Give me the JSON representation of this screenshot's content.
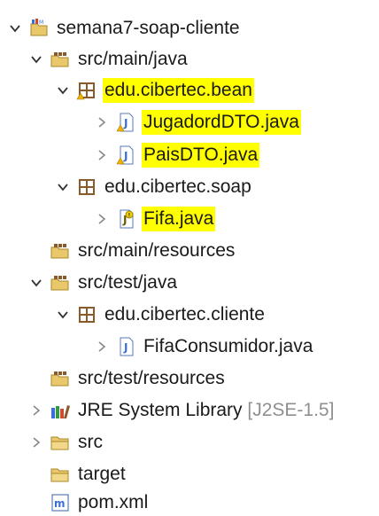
{
  "tree": {
    "project": {
      "label": "semana7-soap-cliente"
    },
    "src_main_java": {
      "label": "src/main/java"
    },
    "pkg_bean": {
      "label": "edu.cibertec.bean"
    },
    "file_jugador": {
      "label": "JugadordDTO.java"
    },
    "file_pais": {
      "label": "PaisDTO.java"
    },
    "pkg_soap": {
      "label": "edu.cibertec.soap"
    },
    "file_fifa": {
      "label": "Fifa.java"
    },
    "src_main_resources": {
      "label": "src/main/resources"
    },
    "src_test_java": {
      "label": "src/test/java"
    },
    "pkg_cliente": {
      "label": "edu.cibertec.cliente"
    },
    "file_consumidor": {
      "label": "FifaConsumidor.java"
    },
    "src_test_resources": {
      "label": "src/test/resources"
    },
    "jre": {
      "label": "JRE System Library",
      "decoration": "[J2SE-1.5]"
    },
    "src": {
      "label": "src"
    },
    "target": {
      "label": "target"
    },
    "pom": {
      "label": "pom.xml"
    }
  },
  "colors": {
    "highlight": "#ffff00",
    "decoration": "#8f8f8f",
    "package": "#8b5a2b",
    "warning": "#f0b400"
  }
}
